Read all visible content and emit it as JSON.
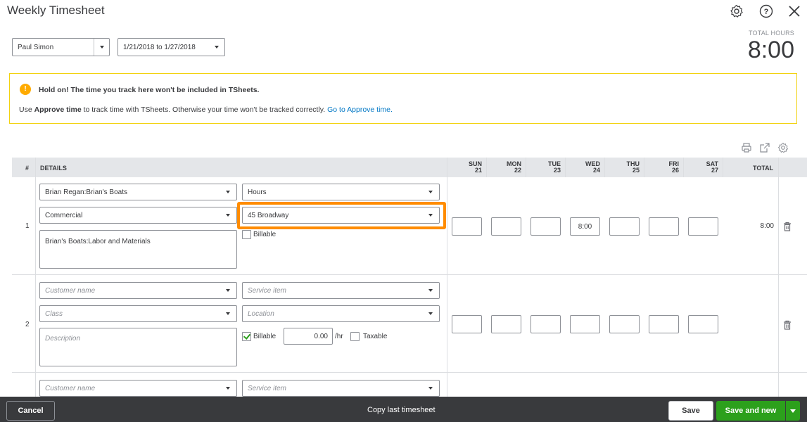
{
  "window": {
    "title": "Weekly Timesheet"
  },
  "header": {
    "employee": "Paul Simon",
    "date_range": "1/21/2018 to 1/27/2018",
    "total_hours_label": "TOTAL HOURS",
    "total_hours_value": "8:00"
  },
  "banner": {
    "title": "Hold on! The time you track here won't be included in TSheets.",
    "body_prefix": "Use ",
    "body_bold": "Approve time",
    "body_middle": " to track time with TSheets. Otherwise your time won't be tracked correctly. ",
    "body_link": "Go to Approve time."
  },
  "table": {
    "col_num": "#",
    "col_details": "DETAILS",
    "days": [
      {
        "name": "SUN",
        "date": "21"
      },
      {
        "name": "MON",
        "date": "22"
      },
      {
        "name": "TUE",
        "date": "23"
      },
      {
        "name": "WED",
        "date": "24"
      },
      {
        "name": "THU",
        "date": "25"
      },
      {
        "name": "FRI",
        "date": "26"
      },
      {
        "name": "SAT",
        "date": "27"
      }
    ],
    "col_total": "TOTAL"
  },
  "rows": [
    {
      "num": "1",
      "customer": "Brian Regan:Brian's Boats",
      "service": "Hours",
      "class": "Commercial",
      "location": "45 Broadway",
      "description": "Brian's Boats:Labor and Materials",
      "billable_label": "Billable",
      "day_values": [
        "",
        "",
        "",
        "8:00",
        "",
        "",
        ""
      ],
      "total": "8:00"
    },
    {
      "num": "2",
      "customer_placeholder": "Customer name",
      "service_placeholder": "Service item",
      "class_placeholder": "Class",
      "location_placeholder": "Location",
      "description_placeholder": "Description",
      "billable_label": "Billable",
      "rate": "0.00",
      "rate_unit": "/hr",
      "taxable_label": "Taxable",
      "day_values": [
        "",
        "",
        "",
        "",
        "",
        "",
        ""
      ]
    },
    {
      "customer_placeholder": "Customer name",
      "service_placeholder": "Service item"
    }
  ],
  "footer": {
    "cancel": "Cancel",
    "copy_last": "Copy last timesheet",
    "save": "Save",
    "save_and_new": "Save and new"
  },
  "colors": {
    "accent_green": "#2ca01c",
    "link_blue": "#0077c5",
    "highlight_orange": "#ff8c00",
    "warning_yellow": "#ffab00",
    "footer_dark": "#393a3d"
  },
  "icons": [
    "gear-icon",
    "help-icon",
    "close-icon",
    "warning-icon",
    "print-icon",
    "export-icon",
    "settings-icon",
    "trash-icon",
    "chevron-down-icon"
  ]
}
